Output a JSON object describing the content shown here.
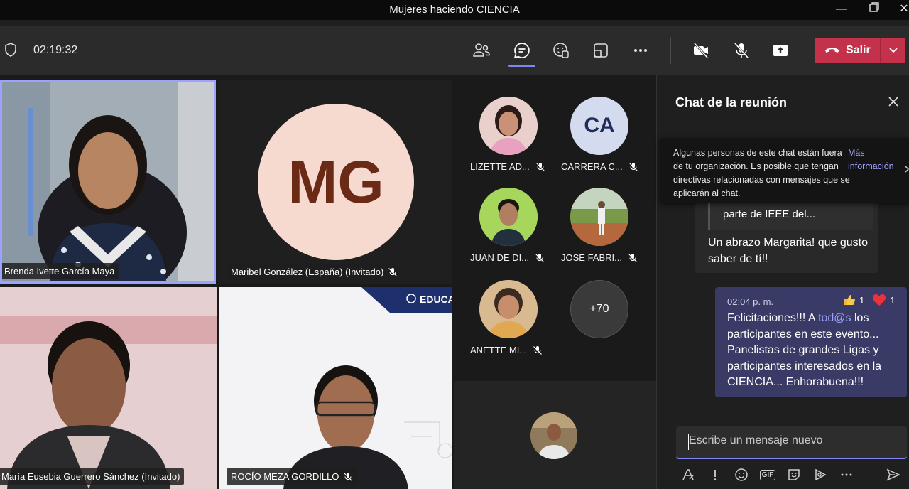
{
  "window": {
    "title": "Mujeres haciendo CIENCIA"
  },
  "toolbar": {
    "timer": "02:19:32",
    "leave_label": "Salir"
  },
  "stage": {
    "tiles": [
      {
        "name": "Brenda Ivette García Maya"
      },
      {
        "name": "Maribel González (España) (Invitado)",
        "initials": "MG"
      },
      {
        "name": "María Eusebia Guerrero Sánchez (Invitado)"
      },
      {
        "name": "ROCÍO MEZA GORDILLO"
      }
    ],
    "gallery": [
      {
        "name": "LIZETTE AD...",
        "initials": ""
      },
      {
        "name": "CARRERA C...",
        "initials": "CA"
      },
      {
        "name": "JUAN DE DI...",
        "initials": ""
      },
      {
        "name": "JOSE FABRI...",
        "initials": ""
      },
      {
        "name": "ANETTE MI...",
        "initials": ""
      }
    ],
    "overflow_count": "+70"
  },
  "chat": {
    "title": "Chat de la reunión",
    "notice_text": "Algunas personas de este chat están fuera de tu organización. Es posible que tengan directivas relacionadas con mensajes que se aplicarán al chat.",
    "notice_link": "Más información",
    "incoming": {
      "quote": "parte de IEEE del...",
      "body": "Un abrazo Margarita! que gusto saber de tí!!"
    },
    "outgoing": {
      "time": "02:04 p. m.",
      "like_count": "1",
      "heart_count": "1",
      "body_pre": "Felicitaciones!!! A ",
      "mention": "tod@s",
      "body_post": " los participantes en este evento... Panelistas de grandes Ligas y participantes interesados en la CIENCIA... Enhorabuena!!!"
    },
    "compose_placeholder": "Escribe un mensaje nuevo",
    "gif_label": "GIF"
  },
  "colors": {
    "accent": "#7f85f5",
    "leave": "#c4314b",
    "own_message": "#393b66"
  }
}
